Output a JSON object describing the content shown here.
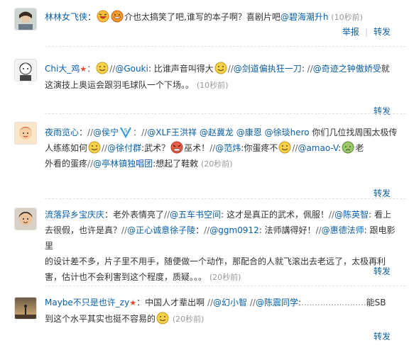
{
  "comments": [
    {
      "user": "林林女飞侠",
      "segments": [
        "：",
        "介也太搞笑了吧,谁写的本子啊？喜剧片吧",
        "@碧海潮升h",
        "(10秒前)"
      ],
      "actions": [
        "举报",
        "转发"
      ]
    },
    {
      "user": "Chi大_鸡",
      "line1": [
        "//",
        "@Gouki",
        ": 比谁声音叫得大",
        "//",
        "@剑道偏执狂一刀",
        ": ",
        "//",
        "@奇迹之钟傲娇受",
        "就"
      ],
      "line2": [
        "这演技上奥运会跟羽毛球队一个下场。。",
        "(10秒前)"
      ],
      "actions": [
        "转发"
      ]
    },
    {
      "user": "夜雨览心",
      "line1": [
        "：",
        "//",
        "@侯宁",
        "：",
        "//",
        "@XLF王洪祥",
        "@赵冀龙",
        "@康恩",
        "@徐琰hero",
        "你们几位找周围太极传"
      ],
      "line2": [
        "人练练如何",
        "//",
        "@徐付群",
        ":武术？",
        "巫术！",
        "//",
        "@范炜",
        ":你蛋疼不",
        "//",
        "@amao-V",
        ":",
        "老"
      ],
      "line3": [
        "外看的蛋疼",
        "//",
        "@亭林镇独唱团",
        ":想起了鞋敕",
        "(20秒前)"
      ],
      "actions": [
        "转发"
      ]
    },
    {
      "user": "流落异乡宝庆庆",
      "line1": [
        "：",
        "老外表情亮了",
        "//",
        "@五车书空间",
        ": 这才是真正的武术，佩服！",
        "//",
        "@陈英智",
        ": 看上"
      ],
      "line2": [
        "去很假，也许是真？",
        "//",
        "@正心诚意徐子陵",
        "：",
        "//",
        "@ggm0912",
        ": 法师講得好！",
        "//",
        "@惠德法师",
        ": 跟电影里"
      ],
      "line3": [
        "的设计差不多，片子里不用手，随便做一个动作，那配合的人就飞滚出去老远了，太极再利"
      ],
      "line4": [
        "害，估计也不会利害到这个程度，质疑。。。",
        "(20秒前)"
      ],
      "actions": [
        "转发"
      ]
    },
    {
      "user": "Maybe不只是也许_zy",
      "line1": [
        "：",
        "中国人才辈出啊",
        "//",
        "@幻小智",
        "//",
        "@陈震同学",
        ":",
        "........................",
        "能SB"
      ],
      "line2": [
        "到这个水平其实也挺不容易的",
        "(20秒前)"
      ],
      "actions": [
        "转发"
      ]
    }
  ],
  "icons": {
    "laugh": "laughing-face-icon",
    "grin": "grinning-face-icon",
    "vip": "vip-badge-icon"
  },
  "colors": {
    "link": "#0a5ea8",
    "time": "#999999",
    "vip": "#e54c2e"
  }
}
